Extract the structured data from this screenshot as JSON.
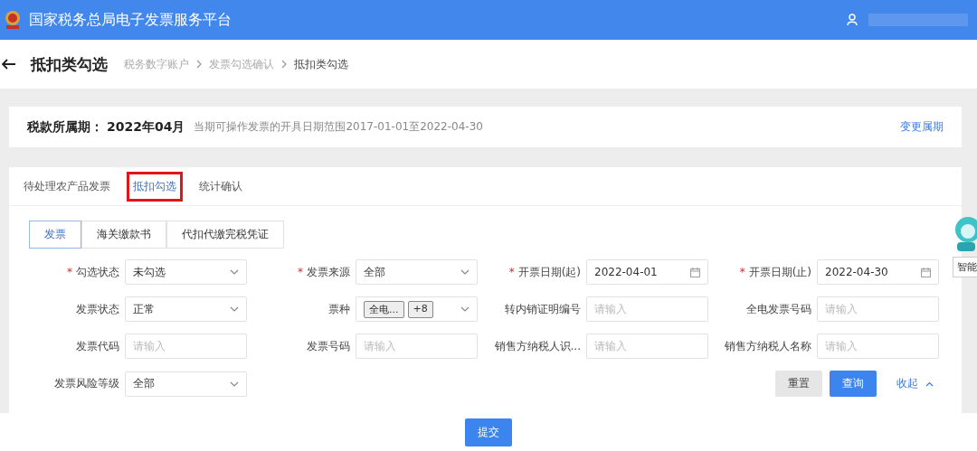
{
  "header": {
    "title": "国家税务总局电子发票服务平台"
  },
  "page": {
    "title": "抵扣类勾选",
    "breadcrumbs": [
      {
        "label": "税务数字账户",
        "current": false
      },
      {
        "label": "发票勾选确认",
        "current": false
      },
      {
        "label": "抵扣类勾选",
        "current": true
      }
    ]
  },
  "period": {
    "label": "税款所属期：",
    "value": "2022年04月",
    "hint": "当期可操作发票的开具日期范围2017-01-01至2022-04-30",
    "link": "变更属期"
  },
  "tabs": [
    {
      "label": "待处理农产品发票",
      "selected": false
    },
    {
      "label": "抵扣勾选",
      "selected": true
    },
    {
      "label": "统计确认",
      "selected": false
    }
  ],
  "segments": [
    {
      "label": "发票",
      "selected": true
    },
    {
      "label": "海关缴款书",
      "selected": false
    },
    {
      "label": "代扣代缴完税凭证",
      "selected": false
    }
  ],
  "fields": [
    {
      "label": "勾选状态",
      "required_mark": "*",
      "kind": "select",
      "value": "未勾选"
    },
    {
      "label": "发票来源",
      "required_mark": "*",
      "kind": "select",
      "value": "全部"
    },
    {
      "label": "开票日期(起)",
      "required_mark": "*",
      "kind": "date",
      "value": "2022-04-01"
    },
    {
      "label": "开票日期(止)",
      "required_mark": "*",
      "kind": "date",
      "value": "2022-04-30"
    },
    {
      "label": "发票状态",
      "kind": "select",
      "value": "正常"
    },
    {
      "label": "票种",
      "kind": "tags",
      "tags": [
        "全电...",
        "+8"
      ]
    },
    {
      "label": "转内销证明编号",
      "kind": "input",
      "placeholder": "请输入"
    },
    {
      "label": "全电发票号码",
      "kind": "input",
      "placeholder": "请输入"
    },
    {
      "label": "发票代码",
      "kind": "input",
      "placeholder": "请输入"
    },
    {
      "label": "发票号码",
      "kind": "input",
      "placeholder": "请输入"
    },
    {
      "label": "销售方纳税人识...",
      "kind": "input",
      "placeholder": "请输入"
    },
    {
      "label": "销售方纳税人名称",
      "kind": "input",
      "placeholder": "请输入"
    },
    {
      "label": "发票风险等级",
      "kind": "select",
      "value": "全部"
    }
  ],
  "actions": {
    "reset": "重置",
    "query": "查询",
    "collapse": "收起"
  },
  "footer": {
    "submit": "提交"
  },
  "assistant": {
    "label": "智能"
  }
}
